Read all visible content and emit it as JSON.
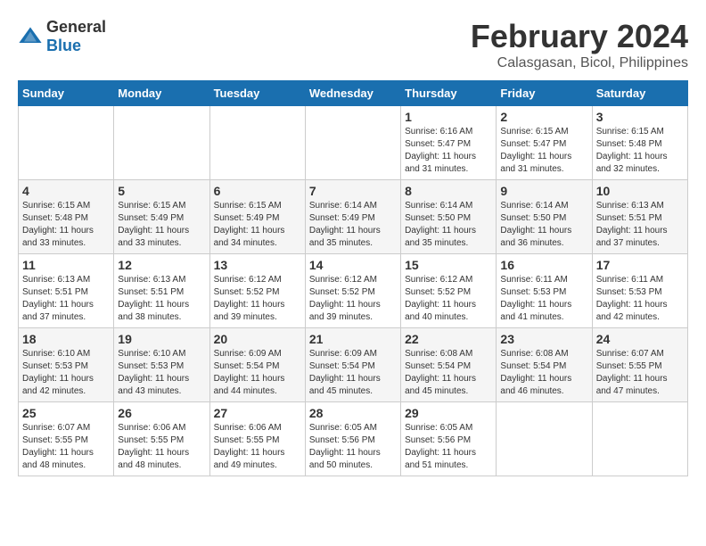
{
  "header": {
    "logo_general": "General",
    "logo_blue": "Blue",
    "main_title": "February 2024",
    "sub_title": "Calasgasan, Bicol, Philippines"
  },
  "calendar": {
    "weekdays": [
      "Sunday",
      "Monday",
      "Tuesday",
      "Wednesday",
      "Thursday",
      "Friday",
      "Saturday"
    ],
    "weeks": [
      [
        {
          "day": "",
          "sunrise": "",
          "sunset": "",
          "daylight": ""
        },
        {
          "day": "",
          "sunrise": "",
          "sunset": "",
          "daylight": ""
        },
        {
          "day": "",
          "sunrise": "",
          "sunset": "",
          "daylight": ""
        },
        {
          "day": "",
          "sunrise": "",
          "sunset": "",
          "daylight": ""
        },
        {
          "day": "1",
          "sunrise": "Sunrise: 6:16 AM",
          "sunset": "Sunset: 5:47 PM",
          "daylight": "Daylight: 11 hours and 31 minutes."
        },
        {
          "day": "2",
          "sunrise": "Sunrise: 6:15 AM",
          "sunset": "Sunset: 5:47 PM",
          "daylight": "Daylight: 11 hours and 31 minutes."
        },
        {
          "day": "3",
          "sunrise": "Sunrise: 6:15 AM",
          "sunset": "Sunset: 5:48 PM",
          "daylight": "Daylight: 11 hours and 32 minutes."
        }
      ],
      [
        {
          "day": "4",
          "sunrise": "Sunrise: 6:15 AM",
          "sunset": "Sunset: 5:48 PM",
          "daylight": "Daylight: 11 hours and 33 minutes."
        },
        {
          "day": "5",
          "sunrise": "Sunrise: 6:15 AM",
          "sunset": "Sunset: 5:49 PM",
          "daylight": "Daylight: 11 hours and 33 minutes."
        },
        {
          "day": "6",
          "sunrise": "Sunrise: 6:15 AM",
          "sunset": "Sunset: 5:49 PM",
          "daylight": "Daylight: 11 hours and 34 minutes."
        },
        {
          "day": "7",
          "sunrise": "Sunrise: 6:14 AM",
          "sunset": "Sunset: 5:49 PM",
          "daylight": "Daylight: 11 hours and 35 minutes."
        },
        {
          "day": "8",
          "sunrise": "Sunrise: 6:14 AM",
          "sunset": "Sunset: 5:50 PM",
          "daylight": "Daylight: 11 hours and 35 minutes."
        },
        {
          "day": "9",
          "sunrise": "Sunrise: 6:14 AM",
          "sunset": "Sunset: 5:50 PM",
          "daylight": "Daylight: 11 hours and 36 minutes."
        },
        {
          "day": "10",
          "sunrise": "Sunrise: 6:13 AM",
          "sunset": "Sunset: 5:51 PM",
          "daylight": "Daylight: 11 hours and 37 minutes."
        }
      ],
      [
        {
          "day": "11",
          "sunrise": "Sunrise: 6:13 AM",
          "sunset": "Sunset: 5:51 PM",
          "daylight": "Daylight: 11 hours and 37 minutes."
        },
        {
          "day": "12",
          "sunrise": "Sunrise: 6:13 AM",
          "sunset": "Sunset: 5:51 PM",
          "daylight": "Daylight: 11 hours and 38 minutes."
        },
        {
          "day": "13",
          "sunrise": "Sunrise: 6:12 AM",
          "sunset": "Sunset: 5:52 PM",
          "daylight": "Daylight: 11 hours and 39 minutes."
        },
        {
          "day": "14",
          "sunrise": "Sunrise: 6:12 AM",
          "sunset": "Sunset: 5:52 PM",
          "daylight": "Daylight: 11 hours and 39 minutes."
        },
        {
          "day": "15",
          "sunrise": "Sunrise: 6:12 AM",
          "sunset": "Sunset: 5:52 PM",
          "daylight": "Daylight: 11 hours and 40 minutes."
        },
        {
          "day": "16",
          "sunrise": "Sunrise: 6:11 AM",
          "sunset": "Sunset: 5:53 PM",
          "daylight": "Daylight: 11 hours and 41 minutes."
        },
        {
          "day": "17",
          "sunrise": "Sunrise: 6:11 AM",
          "sunset": "Sunset: 5:53 PM",
          "daylight": "Daylight: 11 hours and 42 minutes."
        }
      ],
      [
        {
          "day": "18",
          "sunrise": "Sunrise: 6:10 AM",
          "sunset": "Sunset: 5:53 PM",
          "daylight": "Daylight: 11 hours and 42 minutes."
        },
        {
          "day": "19",
          "sunrise": "Sunrise: 6:10 AM",
          "sunset": "Sunset: 5:53 PM",
          "daylight": "Daylight: 11 hours and 43 minutes."
        },
        {
          "day": "20",
          "sunrise": "Sunrise: 6:09 AM",
          "sunset": "Sunset: 5:54 PM",
          "daylight": "Daylight: 11 hours and 44 minutes."
        },
        {
          "day": "21",
          "sunrise": "Sunrise: 6:09 AM",
          "sunset": "Sunset: 5:54 PM",
          "daylight": "Daylight: 11 hours and 45 minutes."
        },
        {
          "day": "22",
          "sunrise": "Sunrise: 6:08 AM",
          "sunset": "Sunset: 5:54 PM",
          "daylight": "Daylight: 11 hours and 45 minutes."
        },
        {
          "day": "23",
          "sunrise": "Sunrise: 6:08 AM",
          "sunset": "Sunset: 5:54 PM",
          "daylight": "Daylight: 11 hours and 46 minutes."
        },
        {
          "day": "24",
          "sunrise": "Sunrise: 6:07 AM",
          "sunset": "Sunset: 5:55 PM",
          "daylight": "Daylight: 11 hours and 47 minutes."
        }
      ],
      [
        {
          "day": "25",
          "sunrise": "Sunrise: 6:07 AM",
          "sunset": "Sunset: 5:55 PM",
          "daylight": "Daylight: 11 hours and 48 minutes."
        },
        {
          "day": "26",
          "sunrise": "Sunrise: 6:06 AM",
          "sunset": "Sunset: 5:55 PM",
          "daylight": "Daylight: 11 hours and 48 minutes."
        },
        {
          "day": "27",
          "sunrise": "Sunrise: 6:06 AM",
          "sunset": "Sunset: 5:55 PM",
          "daylight": "Daylight: 11 hours and 49 minutes."
        },
        {
          "day": "28",
          "sunrise": "Sunrise: 6:05 AM",
          "sunset": "Sunset: 5:56 PM",
          "daylight": "Daylight: 11 hours and 50 minutes."
        },
        {
          "day": "29",
          "sunrise": "Sunrise: 6:05 AM",
          "sunset": "Sunset: 5:56 PM",
          "daylight": "Daylight: 11 hours and 51 minutes."
        },
        {
          "day": "",
          "sunrise": "",
          "sunset": "",
          "daylight": ""
        },
        {
          "day": "",
          "sunrise": "",
          "sunset": "",
          "daylight": ""
        }
      ]
    ]
  }
}
